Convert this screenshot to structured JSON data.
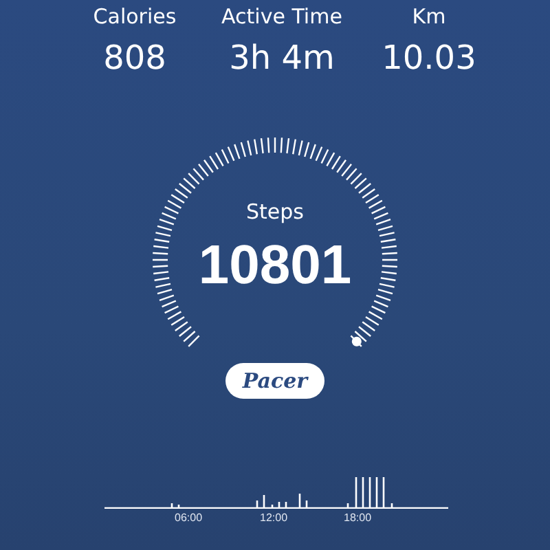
{
  "stats": [
    {
      "label": "Calories",
      "value": "808"
    },
    {
      "label": "Active Time",
      "value": "3h 4m"
    },
    {
      "label": "Km",
      "value": "10.03"
    }
  ],
  "steps": {
    "label": "Steps",
    "value": "10801"
  },
  "brand_button": {
    "label": "Pacer"
  },
  "activity_chart": {
    "time_labels": [
      "06:00",
      "12:00",
      "18:00"
    ]
  }
}
